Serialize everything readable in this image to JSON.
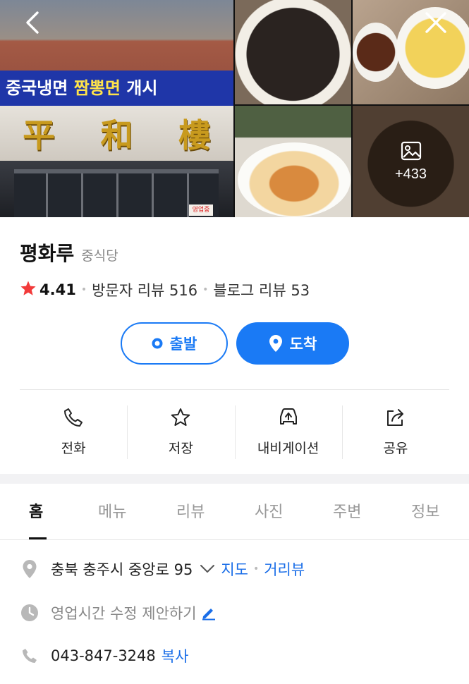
{
  "gallery": {
    "banner_text_part1": "중국냉면 ",
    "banner_text_part2": "짬뽕면",
    "banner_text_part3": " 개시",
    "sign_chars": [
      "平",
      "和",
      "樓"
    ],
    "shop_mini_sign": "영업중",
    "more_count": "+433"
  },
  "place": {
    "name": "평화루",
    "category": "중식당",
    "rating": "4.41",
    "visitor_reviews": "방문자 리뷰 516",
    "blog_reviews": "블로그 리뷰 53"
  },
  "route": {
    "start_label": "출발",
    "arrive_label": "도착"
  },
  "actions": [
    {
      "label": "전화"
    },
    {
      "label": "저장"
    },
    {
      "label": "내비게이션"
    },
    {
      "label": "공유"
    }
  ],
  "tabs": [
    "홈",
    "메뉴",
    "리뷰",
    "사진",
    "주변",
    "정보"
  ],
  "active_tab": "홈",
  "details": {
    "address": "충북 충주시 중앙로 95",
    "map_link": "지도",
    "streetview_link": "거리뷰",
    "hours_suggest": "영업시간 수정 제안하기",
    "phone": "043-847-3248",
    "copy_label": "복사"
  },
  "colors": {
    "accent": "#1a7af5",
    "link": "#1a6ee8",
    "star": "#f23a3a",
    "muted": "#888888"
  }
}
